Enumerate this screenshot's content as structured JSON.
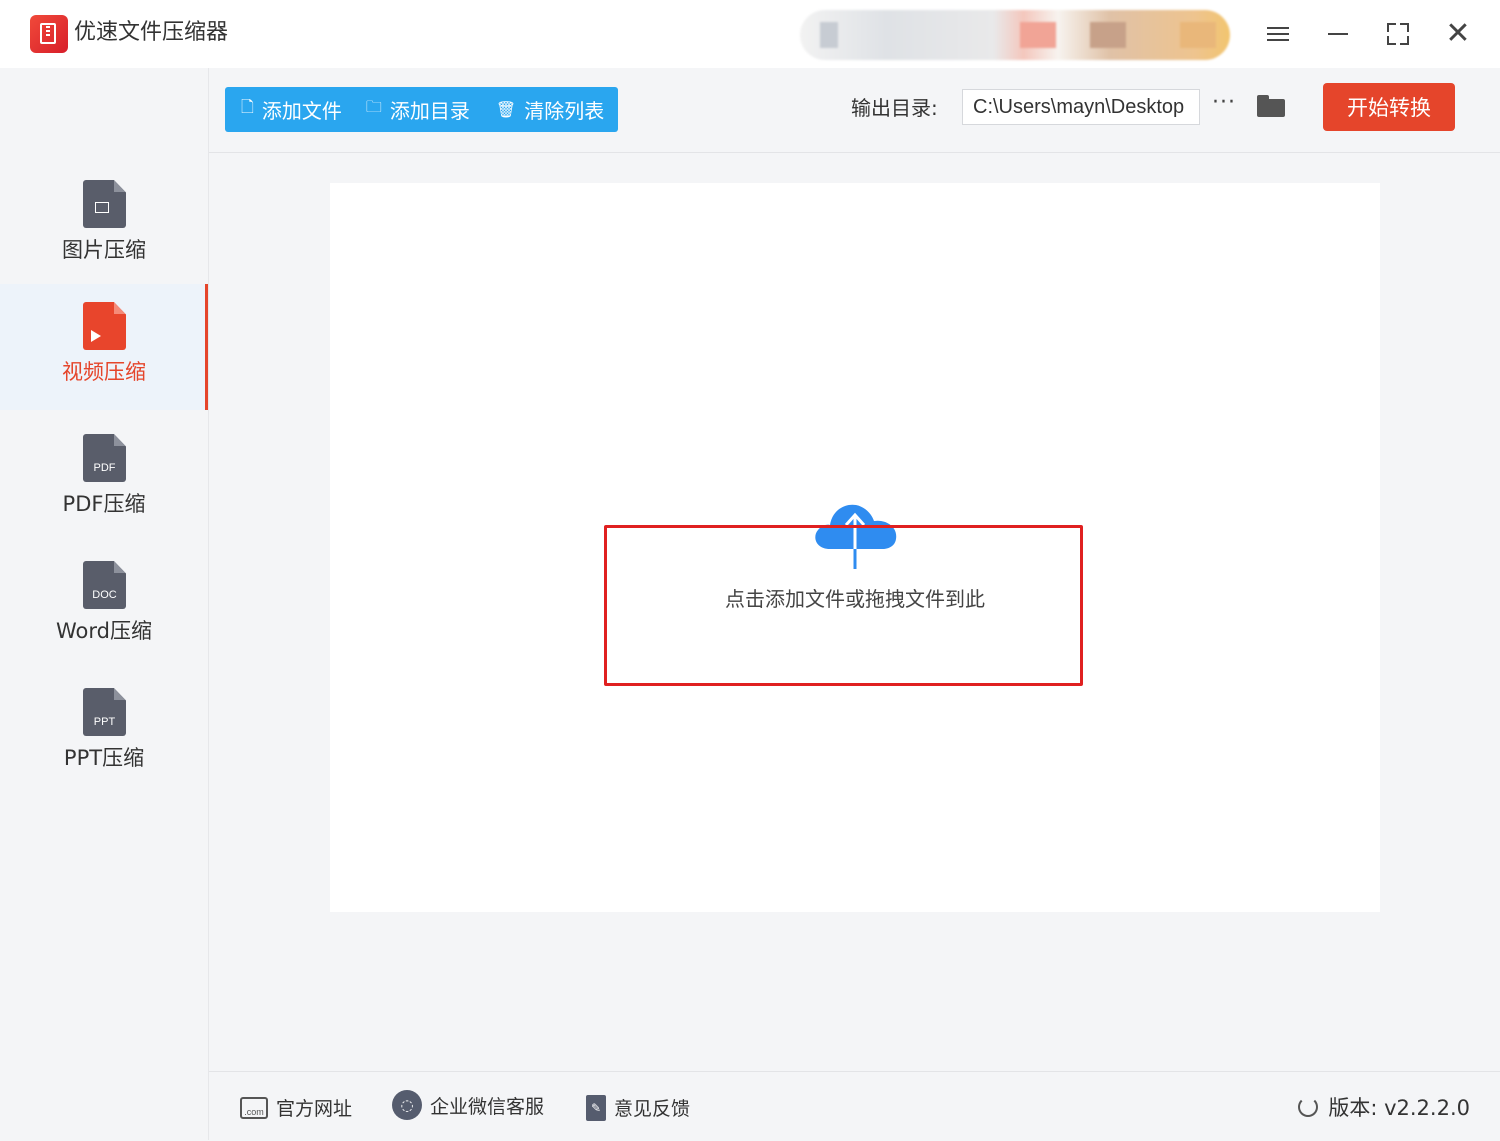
{
  "app": {
    "title": "优速文件压缩器"
  },
  "window_controls": [
    "menu-icon",
    "minimize-icon",
    "maximize-icon",
    "close-icon"
  ],
  "sidebar": {
    "items": [
      {
        "label": "图片压缩",
        "icon": "image-file-icon",
        "icon_text": "",
        "active": false
      },
      {
        "label": "视频压缩",
        "icon": "video-file-icon",
        "icon_text": "",
        "active": true
      },
      {
        "label": "PDF压缩",
        "icon": "pdf-file-icon",
        "icon_text": "PDF",
        "active": false
      },
      {
        "label": "Word压缩",
        "icon": "doc-file-icon",
        "icon_text": "DOC",
        "active": false
      },
      {
        "label": "PPT压缩",
        "icon": "ppt-file-icon",
        "icon_text": "PPT",
        "active": false
      }
    ]
  },
  "toolbar": {
    "add_file": "添加文件",
    "add_dir": "添加目录",
    "clear_list": "清除列表",
    "output_label": "输出目录:",
    "output_path": "C:\\Users\\mayn\\Desktop",
    "more": "···",
    "start": "开始转换"
  },
  "main": {
    "drop_hint": "点击添加文件或拖拽文件到此"
  },
  "footer": {
    "website": "官方网址",
    "wechat": "企业微信客服",
    "feedback": "意见反馈",
    "version": "版本: v2.2.2.0"
  },
  "colors": {
    "accent_red": "#e5452b",
    "toolbar_blue": "#2aa6ef",
    "cloud_blue": "#2f8cf0",
    "highlight_red": "#e02020"
  }
}
